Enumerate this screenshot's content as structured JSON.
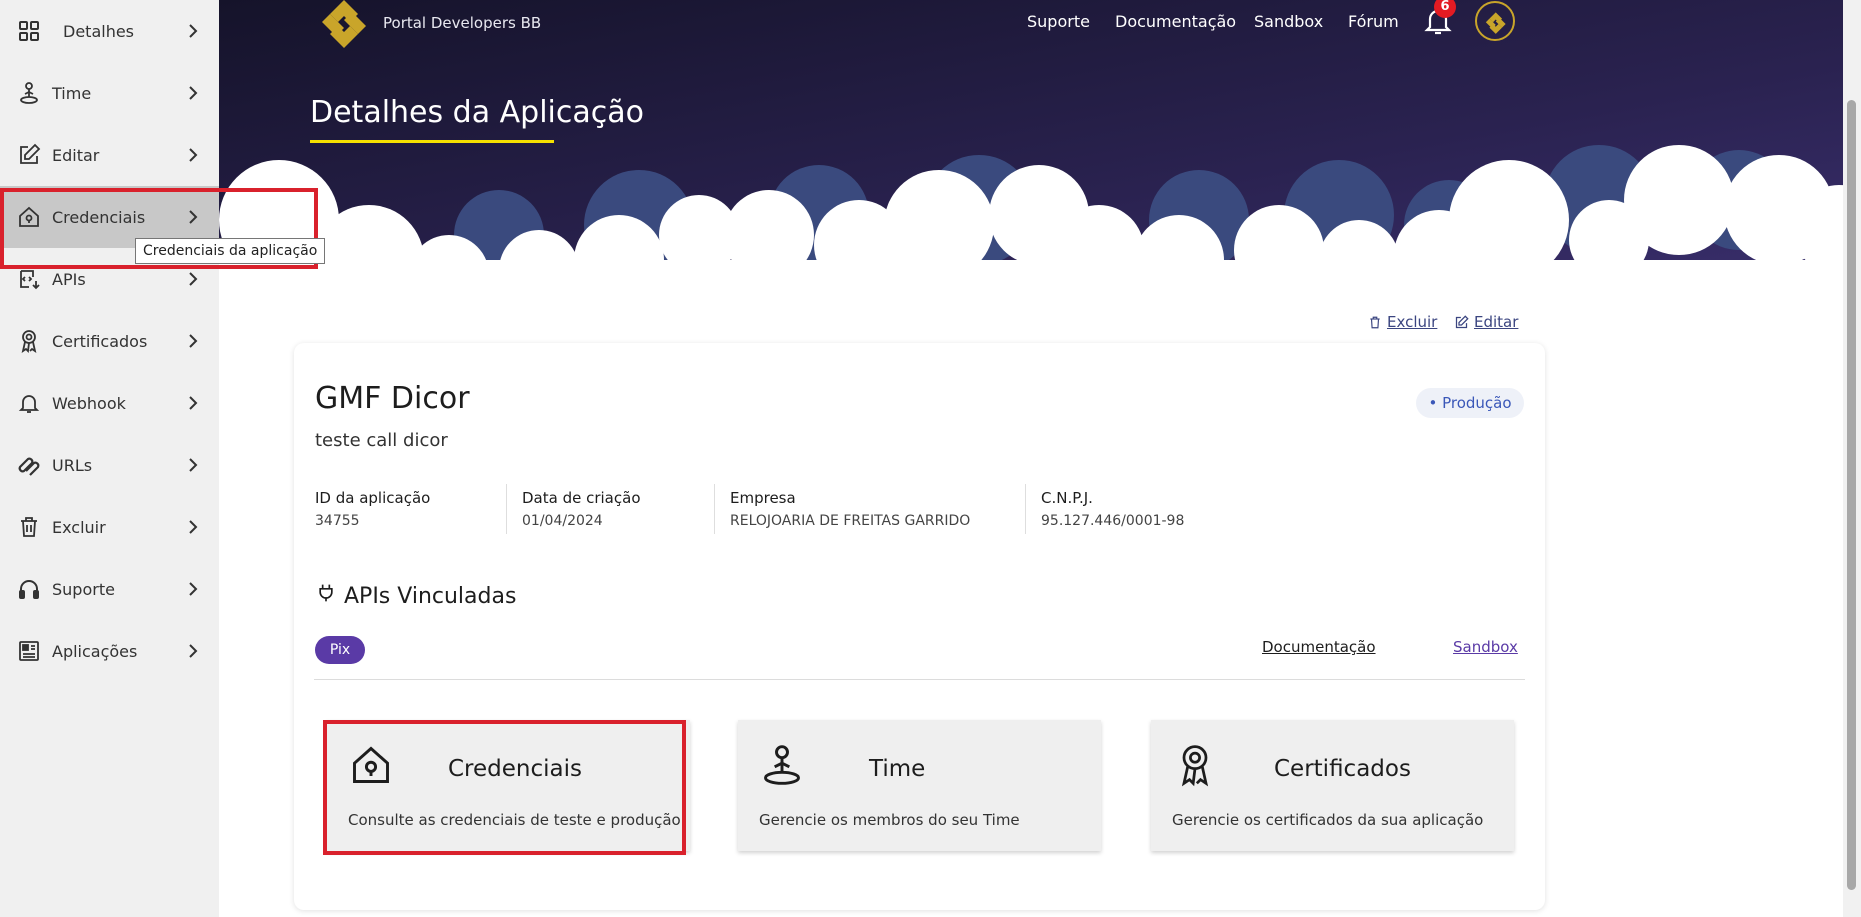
{
  "sidebar": {
    "items": [
      {
        "label": "Detalhes",
        "icon": "grid-icon"
      },
      {
        "label": "Time",
        "icon": "person-pin-icon"
      },
      {
        "label": "Editar",
        "icon": "edit-icon"
      },
      {
        "label": "Credenciais",
        "icon": "house-lock-icon"
      },
      {
        "label": "APIs",
        "icon": "api-icon"
      },
      {
        "label": "Certificados",
        "icon": "ribbon-icon"
      },
      {
        "label": "Webhook",
        "icon": "bell-icon"
      },
      {
        "label": "URLs",
        "icon": "link-icon"
      },
      {
        "label": "Excluir",
        "icon": "trash-icon"
      },
      {
        "label": "Suporte",
        "icon": "headset-icon"
      },
      {
        "label": "Aplicações",
        "icon": "apps-icon"
      }
    ],
    "tooltip": "Credenciais da aplicação"
  },
  "header": {
    "brand": "Portal Developers BB",
    "nav": [
      "Suporte",
      "Documentação",
      "Sandbox",
      "Fórum"
    ],
    "notifications_count": "6",
    "page_title": "Detalhes da Aplicação"
  },
  "actions": {
    "delete": "Excluir",
    "edit": "Editar"
  },
  "app": {
    "name": "GMF Dicor",
    "description": "teste call dicor",
    "environment": "• Produção",
    "info": [
      {
        "label": "ID da aplicação",
        "value": "34755"
      },
      {
        "label": "Data de criação",
        "value": "01/04/2024"
      },
      {
        "label": "Empresa",
        "value": "RELOJOARIA DE FREITAS GARRIDO"
      },
      {
        "label": "C.N.P.J.",
        "value": "95.127.446/0001-98"
      }
    ]
  },
  "apis": {
    "title": "APIs Vinculadas",
    "tag": "Pix",
    "doc_link": "Documentação",
    "sandbox_link": "Sandbox"
  },
  "tiles": [
    {
      "title": "Credenciais",
      "desc": "Consulte as credenciais de teste e produção"
    },
    {
      "title": "Time",
      "desc": "Gerencie os membros do seu Time"
    },
    {
      "title": "Certificados",
      "desc": "Gerencie os certificados da sua aplicação"
    }
  ],
  "colors": {
    "hero_dark": "#1e1a3a",
    "highlight": "#d9212c",
    "accent_yellow": "#f5e000"
  }
}
